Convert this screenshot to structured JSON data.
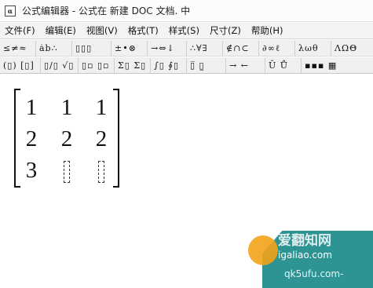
{
  "window": {
    "title": "公式编辑器 - 公式在 新建 DOC 文档. 中"
  },
  "menu": [
    {
      "label": "文件(F)"
    },
    {
      "label": "编辑(E)"
    },
    {
      "label": "视图(V)"
    },
    {
      "label": "格式(T)"
    },
    {
      "label": "样式(S)"
    },
    {
      "label": "尺寸(Z)"
    },
    {
      "label": "帮助(H)"
    }
  ],
  "toolbar_row1": [
    {
      "label": "≤≠≈",
      "icon": "relational-symbols-icon"
    },
    {
      "label": "ȧb∴",
      "icon": "spaces-ellipses-icon"
    },
    {
      "label": "▯▯▯",
      "icon": "embellishments-icon"
    },
    {
      "label": "±•⊗",
      "icon": "operator-symbols-icon"
    },
    {
      "label": "→⇔↓",
      "icon": "arrow-symbols-icon"
    },
    {
      "label": "∴∀∃",
      "icon": "logical-symbols-icon"
    },
    {
      "label": "∉∩⊂",
      "icon": "set-theory-symbols-icon"
    },
    {
      "label": "∂∞ℓ",
      "icon": "misc-symbols-icon"
    },
    {
      "label": "λωθ",
      "icon": "greek-lowercase-icon"
    },
    {
      "label": "ΛΩΘ",
      "icon": "greek-uppercase-icon"
    }
  ],
  "toolbar_row2": [
    {
      "label": "(▯) [▯]",
      "icon": "fence-templates-icon"
    },
    {
      "label": "▯/▯ √▯",
      "icon": "fraction-radical-templates-icon"
    },
    {
      "label": "▯▫ ▯▫",
      "icon": "subscript-superscript-templates-icon"
    },
    {
      "label": "Σ▯ Σ▯",
      "icon": "summation-templates-icon"
    },
    {
      "label": "∫▯ ∮▯",
      "icon": "integral-templates-icon"
    },
    {
      "label": "▯̅ ▯̲",
      "icon": "underbar-overbar-templates-icon"
    },
    {
      "label": "→ ←",
      "icon": "labeled-arrow-templates-icon"
    },
    {
      "label": "Ū Ů",
      "icon": "products-set-theory-templates-icon"
    },
    {
      "label": "▪▪▪ ▦",
      "icon": "matrix-templates-icon"
    }
  ],
  "matrix": {
    "rows": [
      [
        "1",
        "1",
        "1"
      ],
      [
        "2",
        "2",
        "2"
      ],
      [
        "3",
        null,
        null
      ]
    ]
  },
  "watermark": {
    "line1": "爱翻知网",
    "line2": "igaliao.com",
    "line3": "qk5ufu.com-"
  }
}
